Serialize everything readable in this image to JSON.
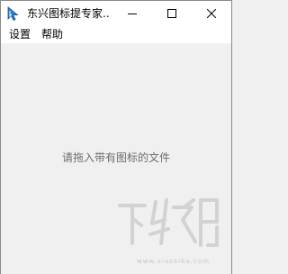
{
  "window": {
    "title": "东兴图标提专家...",
    "app_icon": "cursor-arrow-icon",
    "controls": {
      "minimize_icon": "minimize-icon",
      "maximize_icon": "maximize-icon",
      "close_icon": "close-icon"
    }
  },
  "menu": {
    "items": [
      {
        "label": "设置"
      },
      {
        "label": "帮助"
      }
    ]
  },
  "main": {
    "drop_hint": "请拖入带有图标的文件"
  },
  "watermark": {
    "logo_text": "下载吧",
    "url": "www.xiazaiba.com"
  },
  "colors": {
    "background": "#f0f0f0",
    "hint_text": "#6d6d6d",
    "icon_accent": "#2b7bd6",
    "watermark": "#d2d2d2"
  }
}
